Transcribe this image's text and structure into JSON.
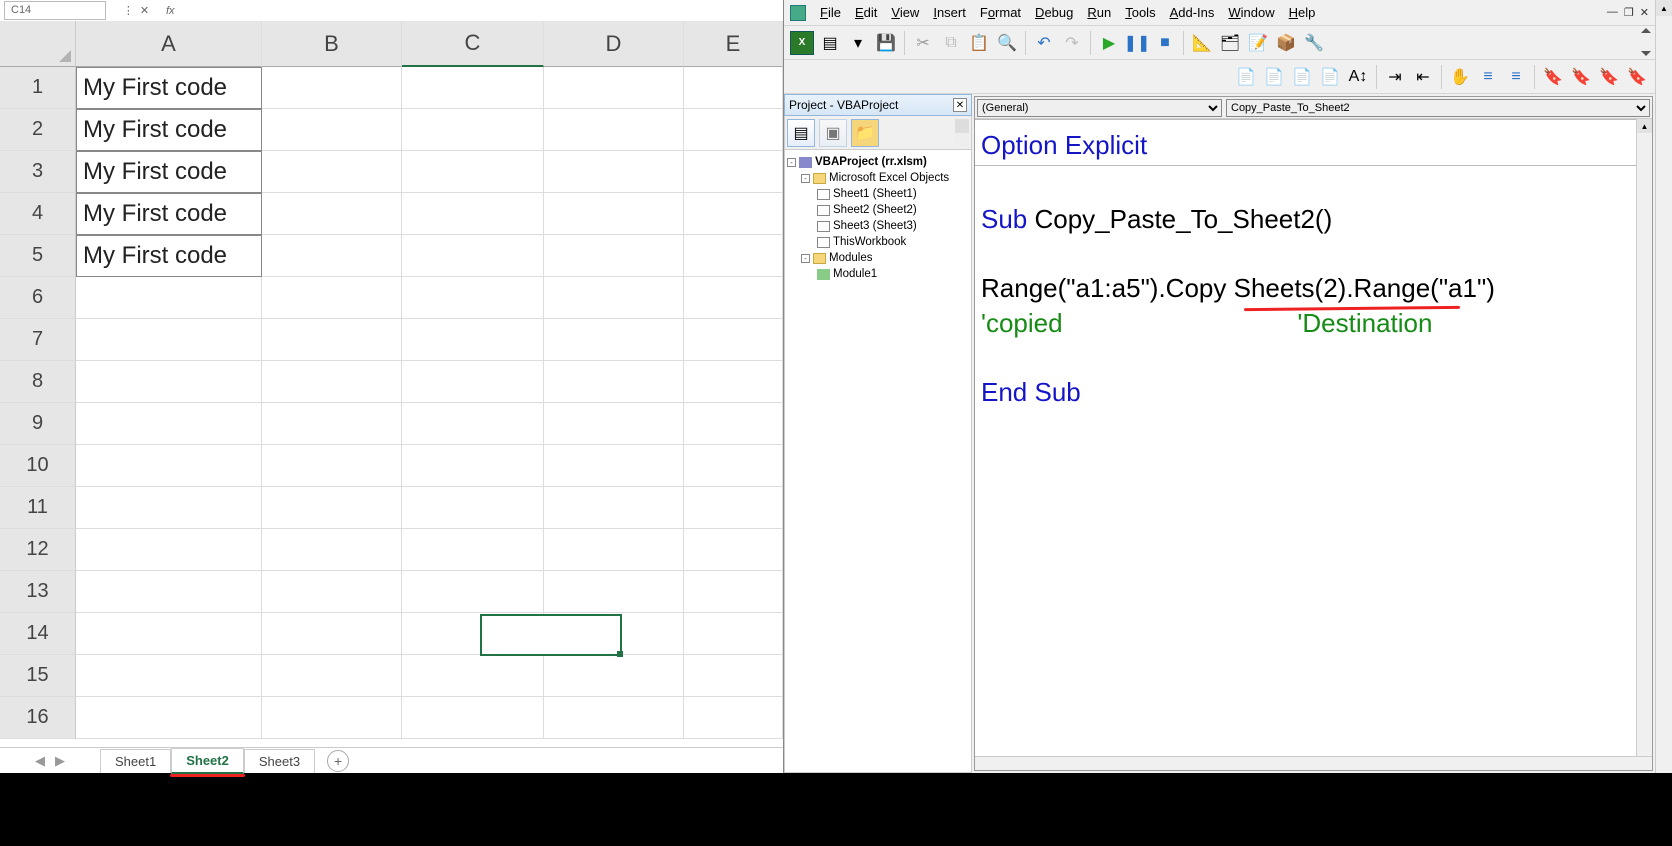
{
  "excel": {
    "name_box": "C14",
    "fx_label": "fx",
    "columns": [
      "A",
      "B",
      "C",
      "D",
      "E"
    ],
    "rows": [
      1,
      2,
      3,
      4,
      5,
      6,
      7,
      8,
      9,
      10,
      11,
      12,
      13,
      14,
      15,
      16
    ],
    "cells": {
      "A1": "My First code",
      "A2": "My First code",
      "A3": "My First code",
      "A4": "My First code",
      "A5": "My First code"
    },
    "tabs": {
      "nav_prev": "◀",
      "nav_next": "▶",
      "sheet1": "Sheet1",
      "sheet2": "Sheet2",
      "sheet3": "Sheet3",
      "add": "+"
    }
  },
  "vba": {
    "menu": {
      "file": "File",
      "edit": "Edit",
      "view": "View",
      "insert": "Insert",
      "format": "Format",
      "debug": "Debug",
      "run": "Run",
      "tools": "Tools",
      "addins": "Add-Ins",
      "window": "Window",
      "help": "Help"
    },
    "window_controls": {
      "min": "—",
      "max": "❐",
      "close": "✕"
    },
    "project_title": "Project - VBAProject",
    "tree": {
      "root": "VBAProject (rr.xlsm)",
      "excel_objects": "Microsoft Excel Objects",
      "sheet1": "Sheet1 (Sheet1)",
      "sheet2": "Sheet2 (Sheet2)",
      "sheet3": "Sheet3 (Sheet3)",
      "thiswb": "ThisWorkbook",
      "modules": "Modules",
      "module1": "Module1"
    },
    "object_dropdown": "(General)",
    "proc_dropdown": "Copy_Paste_To_Sheet2",
    "code": {
      "l1": "Option Explicit",
      "l2": "",
      "l3a": "Sub",
      "l3b": " Copy_Paste_To_Sheet2()",
      "l4": "",
      "l5": "Range(\"a1:a5\").Copy Sheets(2).Range(\"a1\")",
      "l6a": "'copied",
      "l6b": "'Destination",
      "l7": "",
      "l8": "End Sub"
    }
  }
}
